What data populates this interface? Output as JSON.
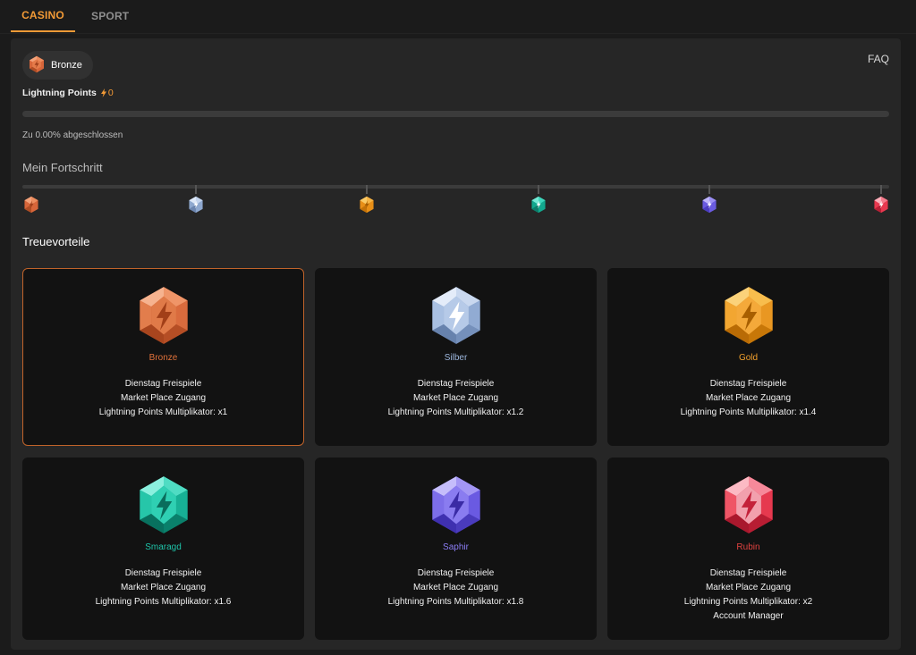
{
  "tabs": [
    {
      "label": "CASINO",
      "active": true
    },
    {
      "label": "SPORT",
      "active": false
    }
  ],
  "header": {
    "tier_label": "Bronze",
    "tier_icon": "bronze-gem-icon",
    "faq_label": "FAQ"
  },
  "points": {
    "label": "Lightning Points",
    "value": "0",
    "icon": "lightning-icon"
  },
  "progress": {
    "percent": 0,
    "completion_text": "Zu 0.00% abgeschlossen"
  },
  "my_progress": {
    "title": "Mein Fortschritt",
    "milestones": [
      {
        "tier": "Bronze",
        "icon": "bronze-gem-icon"
      },
      {
        "tier": "Silber",
        "icon": "silver-gem-icon"
      },
      {
        "tier": "Gold",
        "icon": "gold-gem-icon"
      },
      {
        "tier": "Smaragd",
        "icon": "emerald-gem-icon"
      },
      {
        "tier": "Saphir",
        "icon": "sapphire-gem-icon"
      },
      {
        "tier": "Rubin",
        "icon": "ruby-gem-icon"
      }
    ]
  },
  "loyalty": {
    "title": "Treuevorteile",
    "tiers": [
      {
        "name": "Bronze",
        "name_color": "#e0713a",
        "active": true,
        "icon": "bronze-gem-icon",
        "benefits": [
          "Dienstag Freispiele",
          "Market Place Zugang",
          "Lightning Points Multiplikator: x1"
        ]
      },
      {
        "name": "Silber",
        "name_color": "#9db7dd",
        "active": false,
        "icon": "silver-gem-icon",
        "benefits": [
          "Dienstag Freispiele",
          "Market Place Zugang",
          "Lightning Points Multiplikator: x1.2"
        ]
      },
      {
        "name": "Gold",
        "name_color": "#f3a12c",
        "active": false,
        "icon": "gold-gem-icon",
        "benefits": [
          "Dienstag Freispiele",
          "Market Place Zugang",
          "Lightning Points Multiplikator: x1.4"
        ]
      },
      {
        "name": "Smaragd",
        "name_color": "#1ec4a9",
        "active": false,
        "icon": "emerald-gem-icon",
        "benefits": [
          "Dienstag Freispiele",
          "Market Place Zugang",
          "Lightning Points Multiplikator: x1.6"
        ]
      },
      {
        "name": "Saphir",
        "name_color": "#8a7cf2",
        "active": false,
        "icon": "sapphire-gem-icon",
        "benefits": [
          "Dienstag Freispiele",
          "Market Place Zugang",
          "Lightning Points Multiplikator: x1.8"
        ]
      },
      {
        "name": "Rubin",
        "name_color": "#e0423f",
        "active": false,
        "icon": "ruby-gem-icon",
        "benefits": [
          "Dienstag Freispiele",
          "Market Place Zugang",
          "Lightning Points Multiplikator: x2",
          "Account Manager"
        ]
      }
    ]
  },
  "colors": {
    "accent": "#f29a36",
    "card_bg": "#121212",
    "panel_bg": "#262626",
    "active_border": "#c0632a"
  }
}
